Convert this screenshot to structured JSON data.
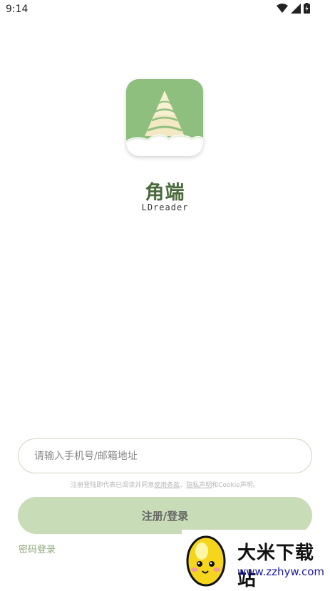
{
  "status_bar": {
    "time": "9:14",
    "icons": [
      "wifi-icon",
      "signal-icon",
      "battery-charging-icon"
    ]
  },
  "brand": {
    "name": "角端",
    "sub": "LDreader",
    "logo_icon": "tower-logo-icon"
  },
  "login": {
    "phone_placeholder": "请输入手机号/邮箱地址",
    "terms_prefix": "注册登陆即代表已阅读并同意",
    "terms_link": "使用条款",
    "terms_sep": "、",
    "privacy_link": "隐私声明",
    "terms_suffix": "和Cookie声明。",
    "register_label": "注册/登录",
    "password_login": "密码登录"
  },
  "watermark": {
    "title": "大米下载站",
    "url": "www.zzhyw.com"
  },
  "colors": {
    "accent": "#8fbf7e",
    "button": "#c8dcb8",
    "brand_text": "#4a6a3c"
  }
}
